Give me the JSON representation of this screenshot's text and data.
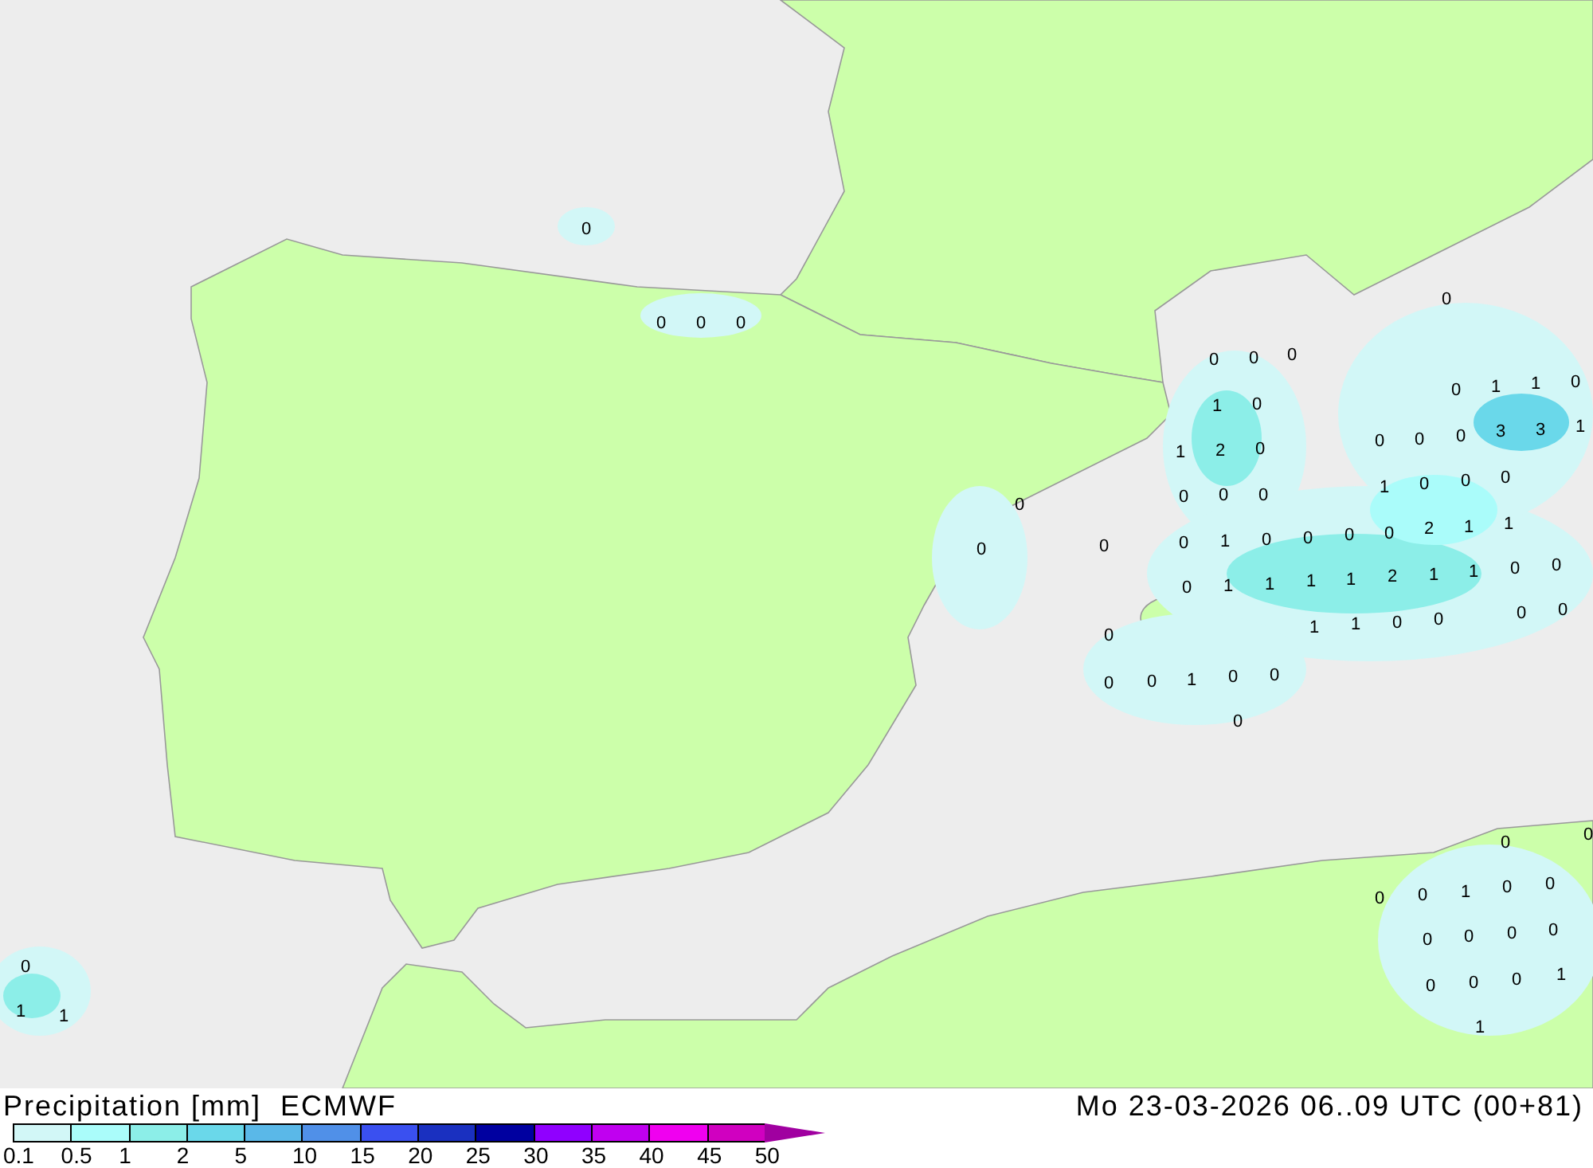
{
  "map_labels": [
    "0",
    "0",
    "0",
    "0",
    "0",
    "0",
    "0",
    "1",
    "0",
    "1",
    "2",
    "0",
    "0",
    "0",
    "0",
    "0",
    "0",
    "0",
    "0",
    "1",
    "0",
    "0",
    "0",
    "0",
    "2",
    "1",
    "1",
    "0",
    "1",
    "1",
    "1",
    "1",
    "2",
    "1",
    "1",
    "0",
    "0",
    "0",
    "1",
    "1",
    "0",
    "0",
    "0",
    "0",
    "0",
    "0",
    "1",
    "0",
    "0",
    "0",
    "0",
    "0",
    "1",
    "1",
    "0",
    "0",
    "0",
    "0",
    "3",
    "3",
    "1",
    "1",
    "0",
    "0",
    "0",
    "0",
    "0",
    "0",
    "0",
    "1",
    "0",
    "0",
    "0",
    "0",
    "0",
    "0",
    "0",
    "0",
    "0",
    "1",
    "1",
    "0",
    "1",
    "1"
  ],
  "legend": {
    "title": "Precipitation [mm]",
    "model": "ECMWF",
    "bins": [
      {
        "color": "#d2f7f7"
      },
      {
        "color": "#aafcfa"
      },
      {
        "color": "#8ceee8"
      },
      {
        "color": "#6ad8ea"
      },
      {
        "color": "#5ab8e8"
      },
      {
        "color": "#5090e8"
      },
      {
        "color": "#3a50f0"
      },
      {
        "color": "#1a30c0"
      },
      {
        "color": "#0000a0"
      },
      {
        "color": "#9000ff"
      },
      {
        "color": "#c000f0"
      },
      {
        "color": "#f000f0"
      },
      {
        "color": "#d000c0"
      }
    ],
    "ticks": [
      "0.1",
      "0.5",
      "1",
      "2",
      "5",
      "10",
      "15",
      "20",
      "25",
      "30",
      "35",
      "40",
      "45",
      "50"
    ]
  },
  "valid_time": "Mo 23-03-2026 06..09 UTC (00+81)"
}
